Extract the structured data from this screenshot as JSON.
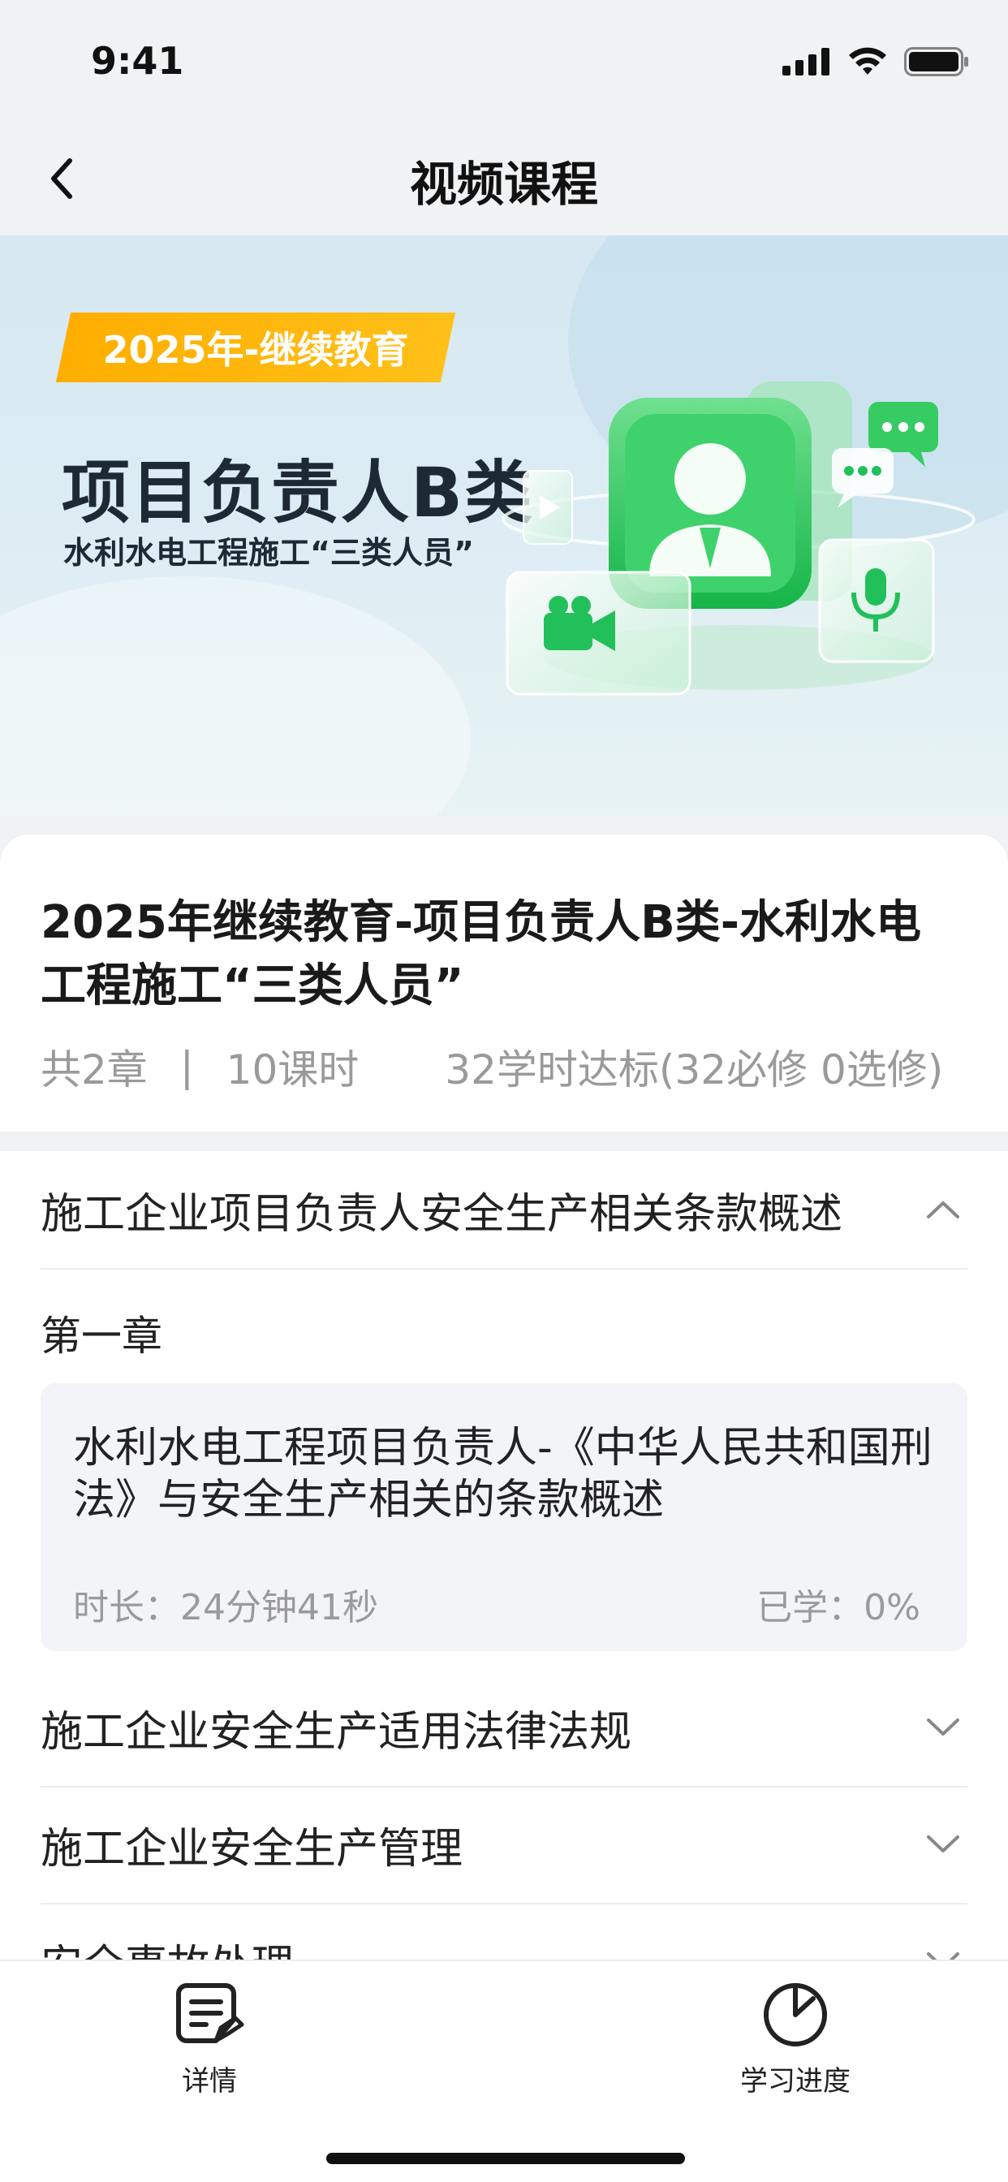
{
  "status_bar": {
    "time": "9:41"
  },
  "nav": {
    "title": "视频课程"
  },
  "banner": {
    "tag": "2025年-继续教育",
    "title": "项目负责人B类",
    "subtitle": "水利水电工程施工“三类人员”"
  },
  "course": {
    "title": "2025年继续教育-项目负责人B类-水利水电工程施工“三类人员”",
    "chapters": "共2章",
    "separator": "|",
    "lessons": "10课时",
    "requirement": "32学时达标(32必修  0选修)"
  },
  "sections": [
    {
      "title": "施工企业项目负责人安全生产相关条款概述",
      "expanded": true
    },
    {
      "title": "施工企业安全生产适用法律法规",
      "expanded": false
    },
    {
      "title": "施工企业安全生产管理",
      "expanded": false
    },
    {
      "title": "安全事故处理",
      "expanded": false
    }
  ],
  "chapter_1": {
    "label": "第一章",
    "lesson": {
      "title": "水利水电工程项目负责人-《中华人民共和国刑法》与安全生产相关的条款概述",
      "duration": "时长：24分钟41秒",
      "progress": "已学：0%"
    }
  },
  "tabs": [
    {
      "label": "详情",
      "icon": "document-icon"
    },
    {
      "label": "学习进度",
      "icon": "progress-icon"
    }
  ],
  "colors": {
    "accent_green": "#2ecc6a",
    "tag_orange": "#ffb400",
    "text_primary": "#222222",
    "text_secondary": "#9a9a9a"
  }
}
